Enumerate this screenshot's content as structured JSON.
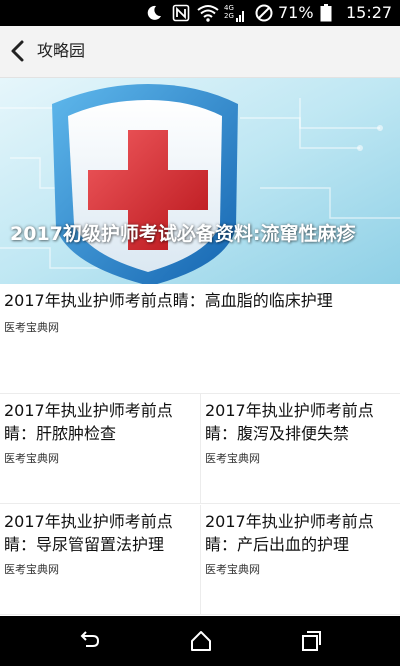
{
  "status_bar": {
    "battery": "71%",
    "time": "15:27",
    "network_label_top": "4G",
    "network_label_bottom": "2G",
    "icons": [
      "moon-icon",
      "nfc-icon",
      "wifi-icon",
      "signal-icon",
      "do-not-disturb-icon"
    ]
  },
  "app_bar": {
    "title": "攻略园",
    "back_icon": "chevron-left-icon"
  },
  "banner": {
    "title": "2017初级护师考试必备资料:流窜性麻疹"
  },
  "articles": [
    {
      "title": "2017年执业护师考前点睛：高血脂的临床护理",
      "source": "医考宝典网"
    },
    {
      "title": "2017年执业护师考前点睛：肝脓肿检查",
      "source": "医考宝典网"
    },
    {
      "title": "2017年执业护师考前点睛：腹泻及排便失禁",
      "source": "医考宝典网"
    },
    {
      "title": "2017年执业护师考前点睛：导尿管留置法护理",
      "source": "医考宝典网"
    },
    {
      "title": "2017年执业护师考前点睛：产后出血的护理",
      "source": "医考宝典网"
    }
  ],
  "nav_bar": {
    "icons": [
      "back-nav-icon",
      "home-icon",
      "recents-icon"
    ]
  },
  "colors": {
    "status_bar": "#000000",
    "app_bar": "#f3f3f3",
    "shield_blue": "#1f86cf",
    "cross_red": "#d9242a"
  }
}
